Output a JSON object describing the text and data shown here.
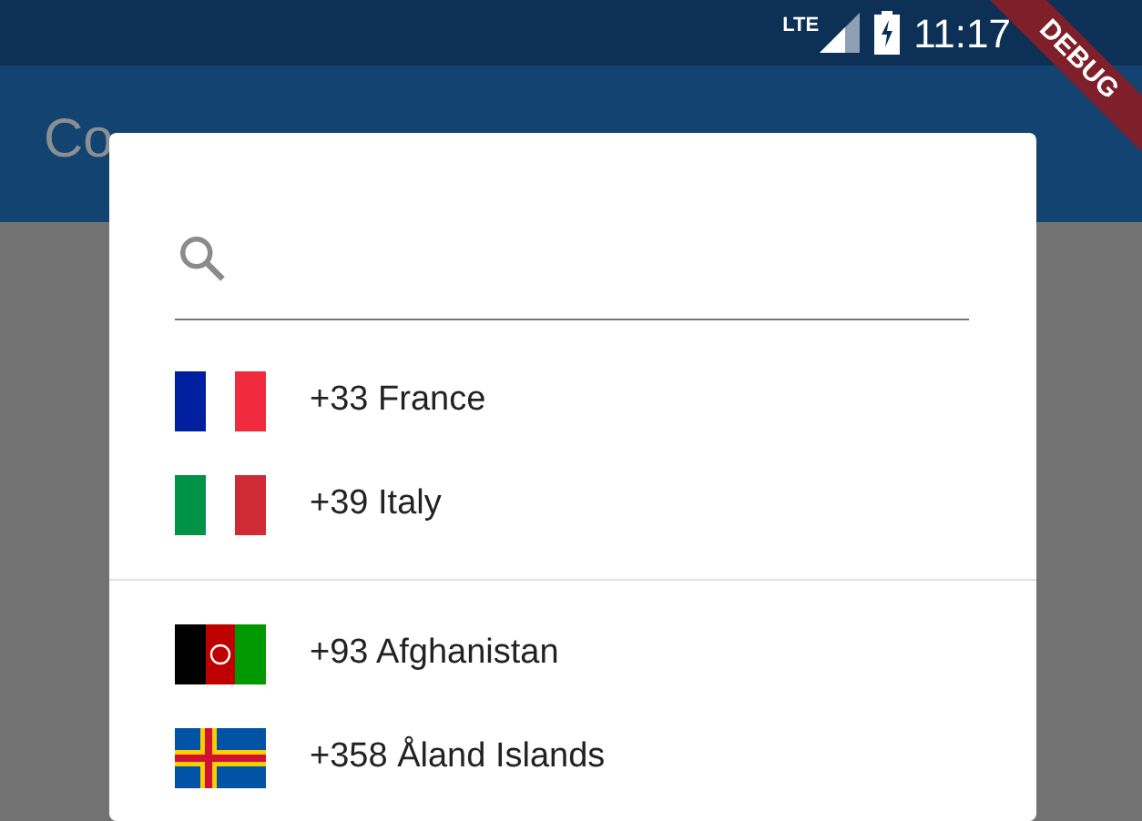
{
  "status_bar": {
    "network": "LTE",
    "time": "11:17"
  },
  "app_bar": {
    "title": "Co"
  },
  "debug_banner": "DEBUG",
  "dialog": {
    "favorites": [
      {
        "code": "+33",
        "name": "France",
        "kind": "fr"
      },
      {
        "code": "+39",
        "name": "Italy",
        "kind": "it"
      }
    ],
    "countries": [
      {
        "code": "+93",
        "name": "Afghanistan",
        "kind": "af"
      },
      {
        "code": "+358",
        "name": "Åland Islands",
        "kind": "ax"
      }
    ]
  }
}
